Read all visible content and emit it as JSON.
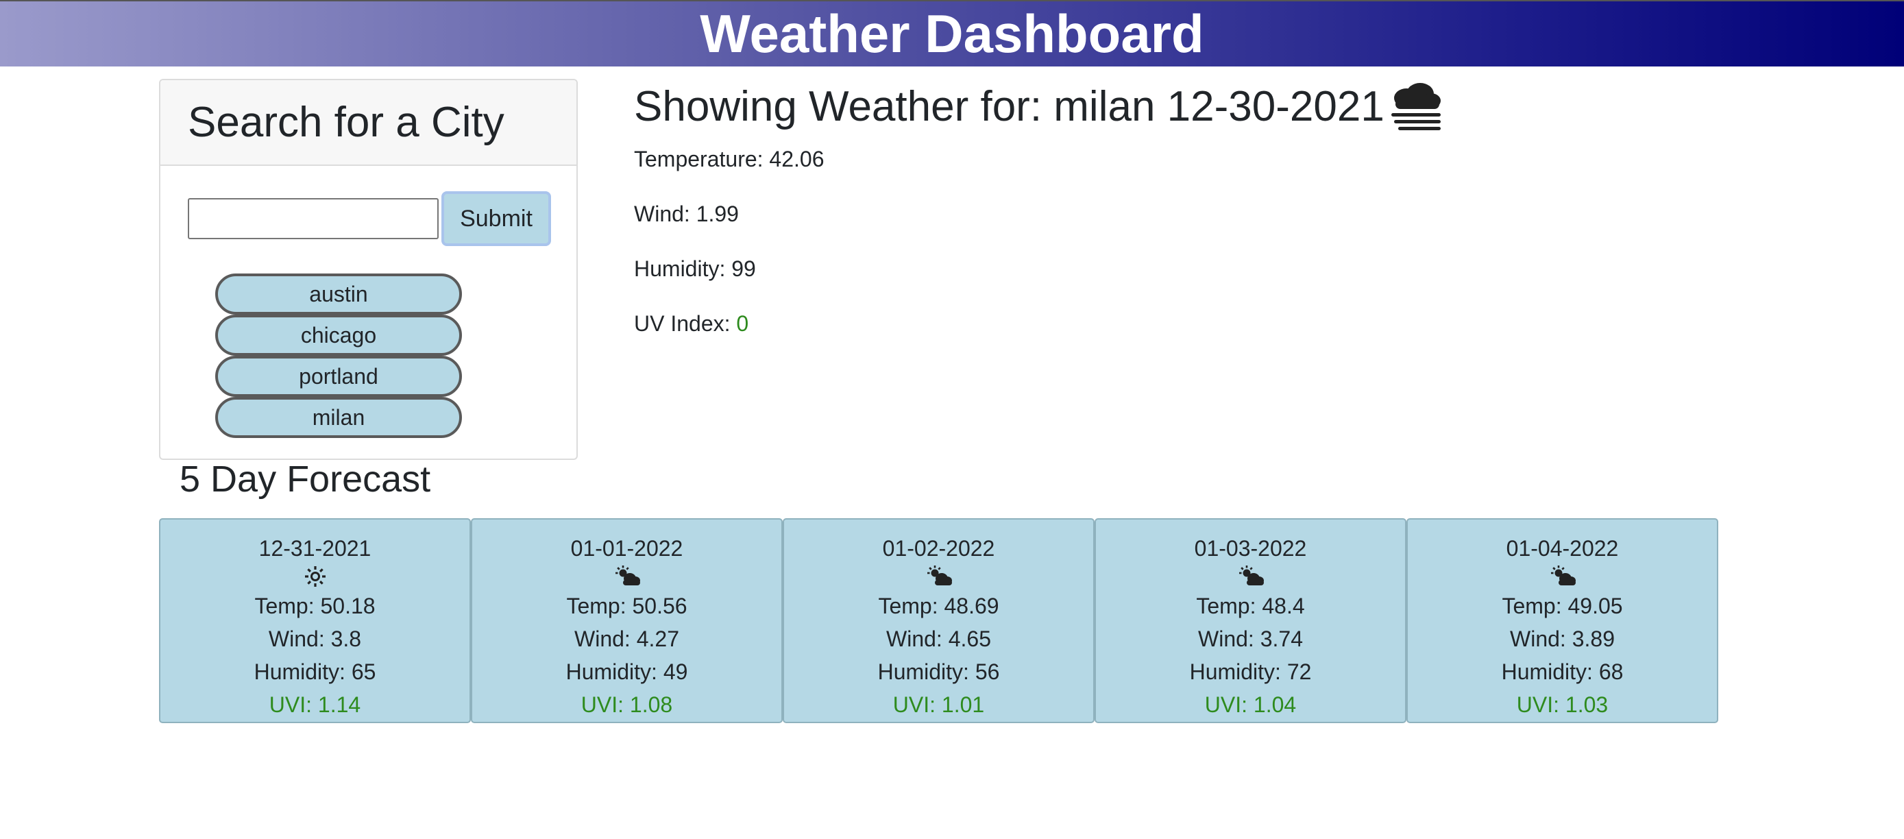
{
  "header": {
    "title": "Weather Dashboard"
  },
  "search": {
    "heading": "Search for a City",
    "input_value": "",
    "submit_label": "Submit",
    "history": [
      "austin",
      "chicago",
      "portland",
      "milan"
    ]
  },
  "current": {
    "title": "Showing Weather for: milan 12-30-2021",
    "icon": "fog-icon",
    "temperature_label": "Temperature: 42.06",
    "wind_label": "Wind: 1.99",
    "humidity_label": "Humidity: 99",
    "uv_label": "UV Index: ",
    "uv_value": "0"
  },
  "forecast": {
    "title": "5 Day Forecast",
    "days": [
      {
        "date": "12-31-2021",
        "icon": "sun-icon",
        "temp": "Temp: 50.18",
        "wind": "Wind: 3.8",
        "humidity": "Humidity: 65",
        "uvi": "UVI: 1.14"
      },
      {
        "date": "01-01-2022",
        "icon": "partly-cloudy-icon",
        "temp": "Temp: 50.56",
        "wind": "Wind: 4.27",
        "humidity": "Humidity: 49",
        "uvi": "UVI: 1.08"
      },
      {
        "date": "01-02-2022",
        "icon": "partly-cloudy-icon",
        "temp": "Temp: 48.69",
        "wind": "Wind: 4.65",
        "humidity": "Humidity: 56",
        "uvi": "UVI: 1.01"
      },
      {
        "date": "01-03-2022",
        "icon": "partly-cloudy-icon",
        "temp": "Temp: 48.4",
        "wind": "Wind: 3.74",
        "humidity": "Humidity: 72",
        "uvi": "UVI: 1.04"
      },
      {
        "date": "01-04-2022",
        "icon": "partly-cloudy-icon",
        "temp": "Temp: 49.05",
        "wind": "Wind: 3.89",
        "humidity": "Humidity: 68",
        "uvi": "UVI: 1.03"
      }
    ]
  },
  "colors": {
    "header_gradient_start": "#9a9acb",
    "header_gradient_end": "#000078",
    "card_background": "#b5d8e5",
    "uv_text": "#2e8b1e"
  }
}
